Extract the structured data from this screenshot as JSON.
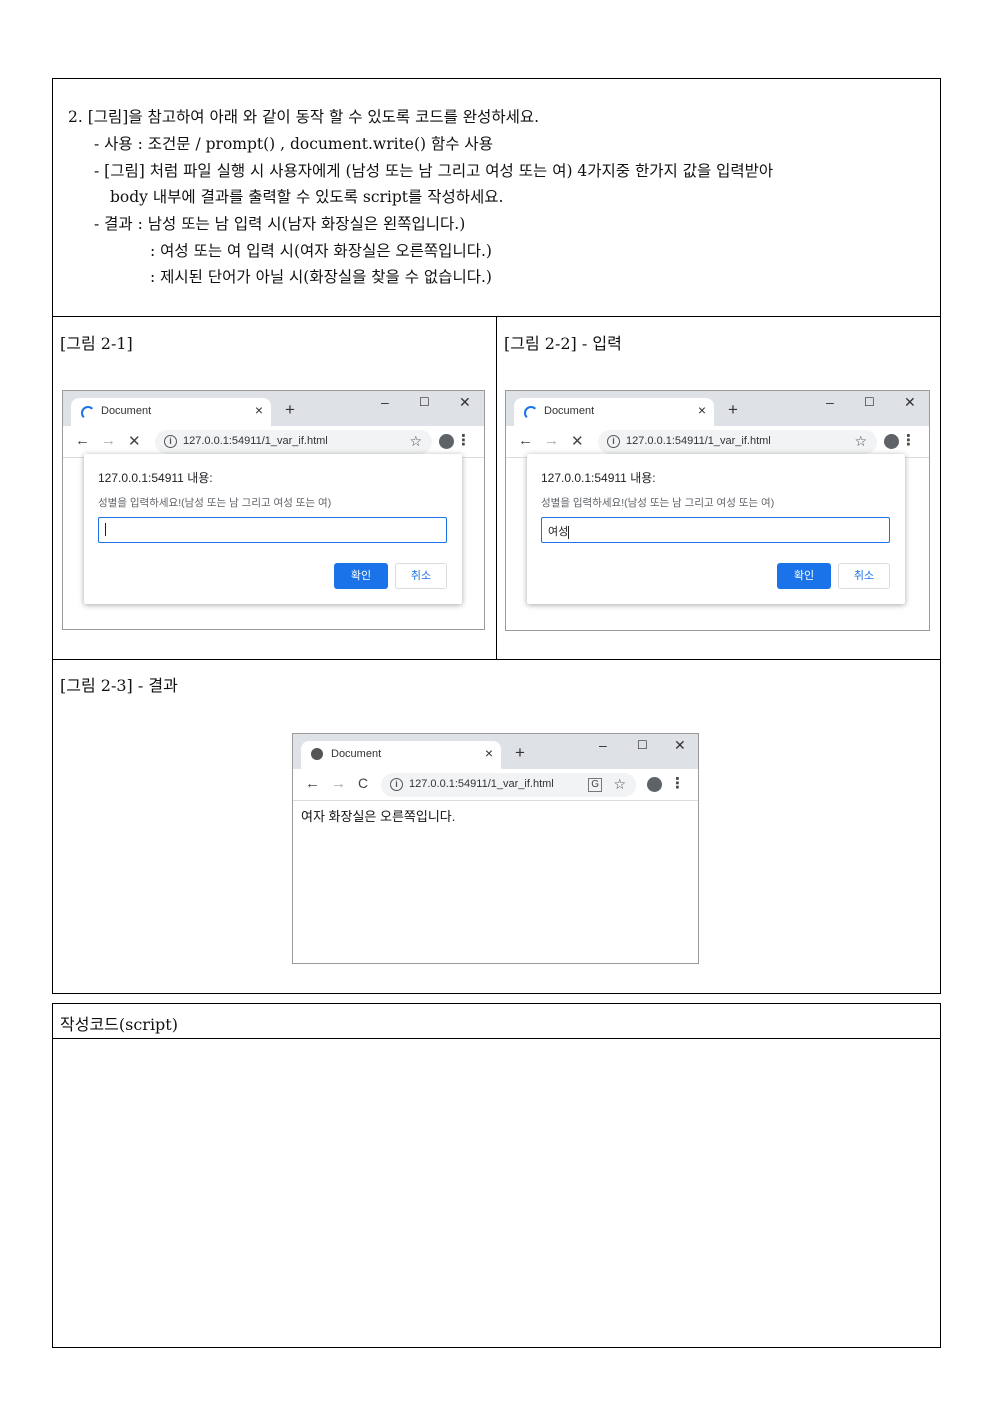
{
  "question": {
    "lines": [
      "2. [그림]을 참고하여 아래 와 같이 동작 할 수 있도록 코드를 완성하세요.",
      "- 사용 : 조건문 / prompt() , document.write() 함수 사용",
      "- [그림] 처럼 파일 실행 시 사용자에게 (남성 또는 남 그리고 여성 또는 여) 4가지중 한가지 값을 입력받아",
      "body 내부에 결과를 출력할 수 있도록 script를 작성하세요.",
      "- 결과 : 남성 또는 남 입력 시(남자 화장실은 왼쪽입니다.)",
      ": 여성 또는 여 입력 시(여자 화장실은 오른쪽입니다.)",
      ": 제시된 단어가 아닐 시(화장실을 찾을 수 없습니다.)"
    ]
  },
  "figures": {
    "fig1_caption": "[그림 2-1]",
    "fig2_caption": "[그림 2-2] - 입력",
    "fig3_caption": "[그림 2-3] - 결과"
  },
  "browser": {
    "tab_title": "Document",
    "tab_close": "×",
    "new_tab": "+",
    "minimize": "–",
    "maximize": "☐",
    "close": "✕",
    "back": "←",
    "forward": "→",
    "stop": "✕",
    "reload": "C",
    "info": "i",
    "url": "127.0.0.1:54911/1_var_if.html",
    "star": "☆",
    "menu": "⋮",
    "translate": "G"
  },
  "dialog": {
    "title": "127.0.0.1:54911 내용:",
    "message": "성별을 입력하세요!(남성 또는 남 그리고 여성 또는 여)",
    "input_value_fig1": "",
    "input_value_fig2": "여성",
    "ok_label": "확인",
    "cancel_label": "취소"
  },
  "result": {
    "output_text": "여자 화장실은 오른쪽입니다."
  },
  "code_section": {
    "title": "작성코드(script)"
  }
}
